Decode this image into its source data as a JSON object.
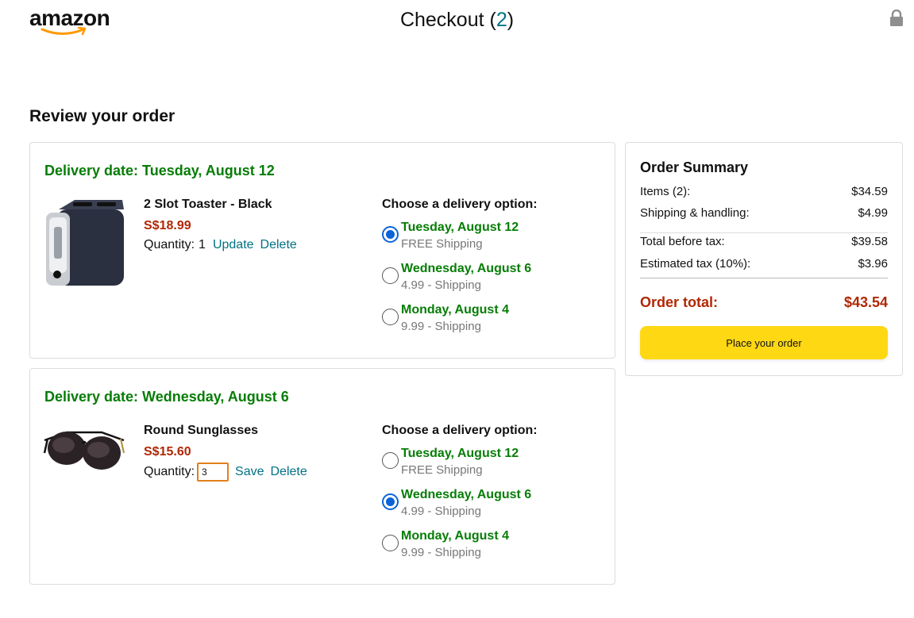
{
  "header": {
    "logo_text": "amazon",
    "title": "Checkout (",
    "count": "2",
    "title_end": ")"
  },
  "page_title": "Review your order",
  "orders": [
    {
      "delivery_date": "Delivery date: Tuesday, August 12",
      "product_name": "2 Slot Toaster - Black",
      "price": "S$18.99",
      "quantity_label": "Quantity:",
      "quantity": "1",
      "link1": "Update",
      "link2": "Delete",
      "options_title": "Choose a delivery option:",
      "options": [
        {
          "date": "Tuesday, August 12",
          "shipping": "FREE Shipping",
          "selected": true
        },
        {
          "date": "Wednesday, August 6",
          "shipping": "4.99 - Shipping",
          "selected": false
        },
        {
          "date": "Monday, August 4",
          "shipping": "9.99 - Shipping",
          "selected": false
        }
      ]
    },
    {
      "delivery_date": "Delivery date: Wednesday, August 6",
      "product_name": "Round Sunglasses",
      "price": "S$15.60",
      "quantity_label": "Quantity:",
      "quantity": "3",
      "link1": "Save",
      "link2": "Delete",
      "options_title": "Choose a delivery option:",
      "options": [
        {
          "date": "Tuesday, August 12",
          "shipping": "FREE Shipping",
          "selected": false
        },
        {
          "date": "Wednesday, August 6",
          "shipping": "4.99 - Shipping",
          "selected": true
        },
        {
          "date": "Monday, August 4",
          "shipping": "9.99 - Shipping",
          "selected": false
        }
      ]
    }
  ],
  "summary": {
    "title": "Order Summary",
    "rows": [
      {
        "label": "Items (2):",
        "value": "$34.59"
      },
      {
        "label": "Shipping & handling:",
        "value": "$4.99"
      },
      {
        "label": "Total before tax:",
        "value": "$39.58"
      },
      {
        "label": "Estimated tax (10%):",
        "value": "$3.96"
      }
    ],
    "total_label": "Order total:",
    "total_value": "$43.54",
    "button_label": "Place your order"
  },
  "colors": {
    "green": "#067d06",
    "price_red": "#b12704",
    "link_teal": "#017185",
    "button_yellow": "#ffd814",
    "radio_blue": "#0a63d8"
  }
}
